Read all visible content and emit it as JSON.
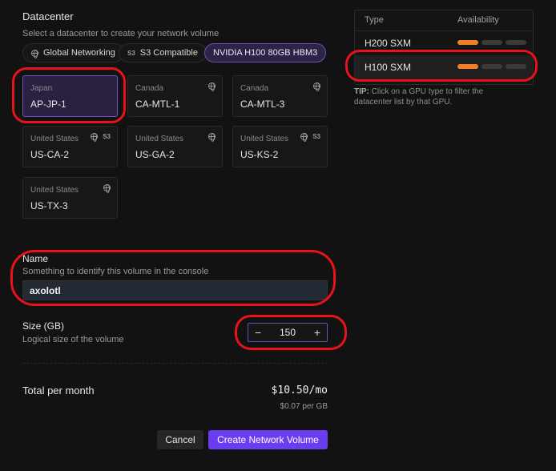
{
  "datacenter": {
    "title": "Datacenter",
    "subtitle": "Select a datacenter to create your network volume",
    "filters": [
      {
        "label": "Global Networking",
        "icon": "globe-icon"
      },
      {
        "label": "S3 Compatible",
        "icon": "s3-icon",
        "icon_text": "S3"
      },
      {
        "label": "NVIDIA H100 80GB HBM3"
      }
    ],
    "cards": [
      {
        "country": "Japan",
        "code": "AP-JP-1",
        "selected": true
      },
      {
        "country": "Canada",
        "code": "CA-MTL-1",
        "globe": true
      },
      {
        "country": "Canada",
        "code": "CA-MTL-3",
        "globe": true
      },
      {
        "country": "United States",
        "code": "US-CA-2",
        "globe": true,
        "s3": "S3"
      },
      {
        "country": "United States",
        "code": "US-GA-2",
        "globe": true
      },
      {
        "country": "United States",
        "code": "US-KS-2",
        "globe": true,
        "s3": "S3"
      },
      {
        "country": "United States",
        "code": "US-TX-3",
        "globe": true
      }
    ]
  },
  "name": {
    "title": "Name",
    "subtitle": "Something to identify this volume in the console",
    "value": "axolotl"
  },
  "size": {
    "title": "Size (GB)",
    "subtitle": "Logical size of the volume",
    "value": "150",
    "minus": "−",
    "plus": "+"
  },
  "total": {
    "label": "Total per month",
    "amount": "$10.50/mo",
    "rate": "$0.07 per GB"
  },
  "actions": {
    "cancel": "Cancel",
    "create": "Create Network Volume"
  },
  "gpu_panel": {
    "col_type": "Type",
    "col_availability": "Availability",
    "rows": [
      {
        "type": "H200 SXM",
        "availability_level": 1,
        "availability_max": 3
      },
      {
        "type": "H100 SXM",
        "availability_level": 1,
        "availability_max": 3,
        "highlighted": true
      }
    ],
    "tip_label": "TIP:",
    "tip_text": "Click on a GPU type to filter the datacenter list by that GPU."
  },
  "colors": {
    "accent": "#6b3df0",
    "availability_on": "#f07f2a",
    "annotation": "#e8121b"
  }
}
